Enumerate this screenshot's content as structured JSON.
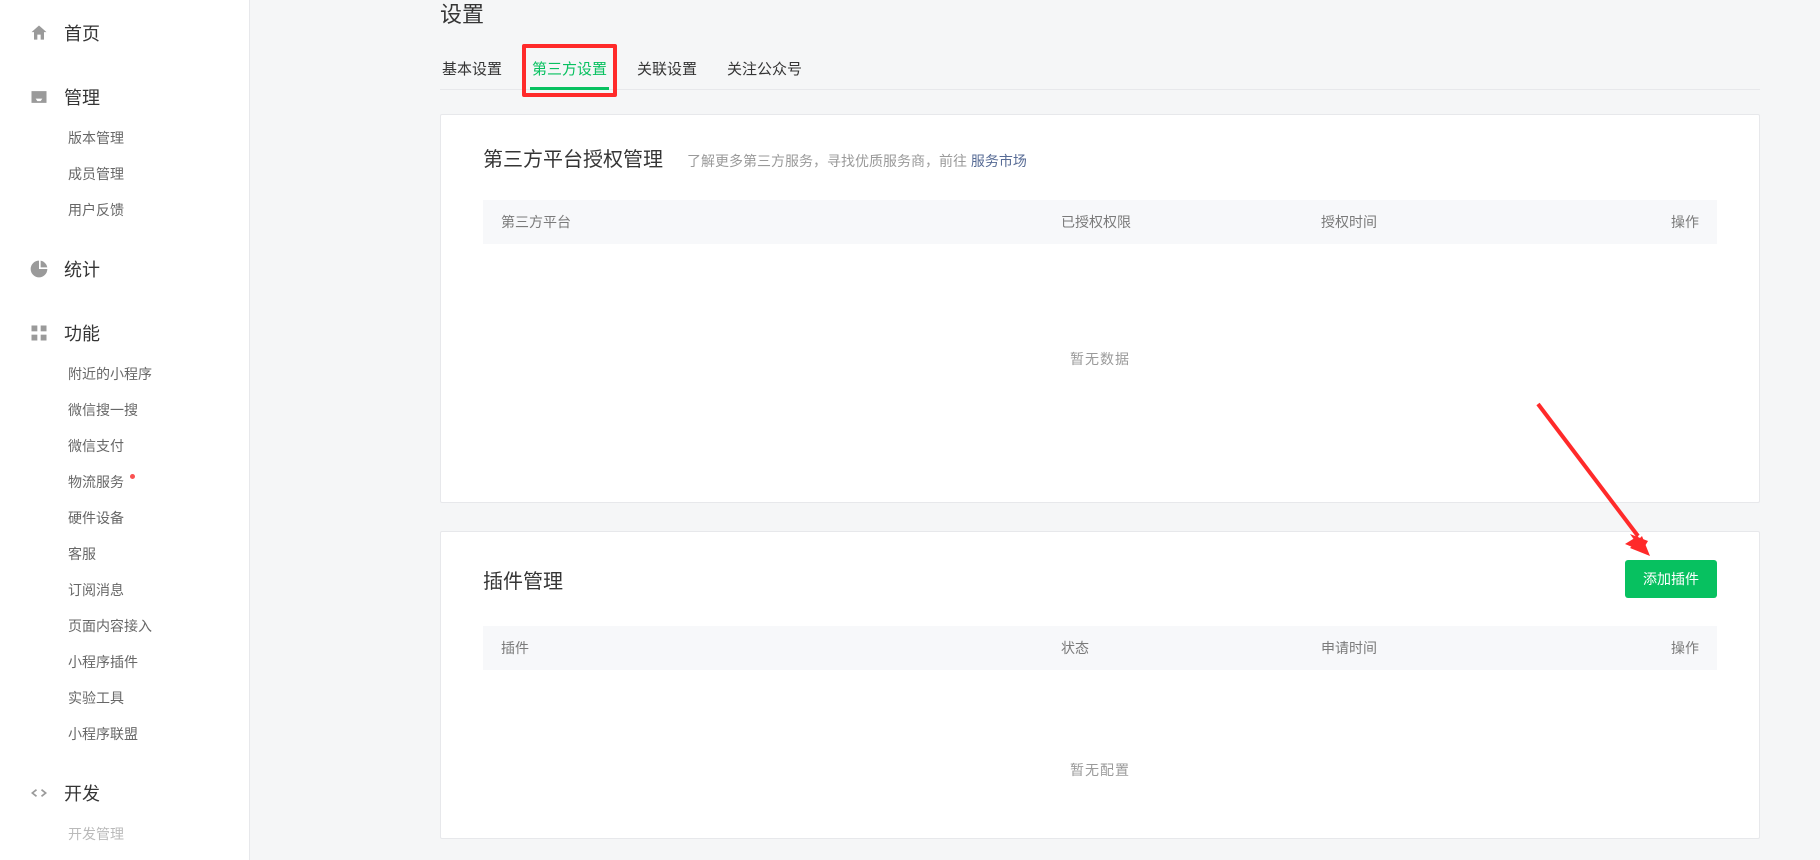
{
  "sidebar": {
    "home": "首页",
    "manage": "管理",
    "manage_items": [
      "版本管理",
      "成员管理",
      "用户反馈"
    ],
    "stats": "统计",
    "features": "功能",
    "feature_items": [
      {
        "label": "附近的小程序"
      },
      {
        "label": "微信搜一搜"
      },
      {
        "label": "微信支付"
      },
      {
        "label": "物流服务",
        "dot": true
      },
      {
        "label": "硬件设备"
      },
      {
        "label": "客服"
      },
      {
        "label": "订阅消息"
      },
      {
        "label": "页面内容接入"
      },
      {
        "label": "小程序插件"
      },
      {
        "label": "实验工具"
      },
      {
        "label": "小程序联盟"
      }
    ],
    "develop": "开发",
    "develop_items": [
      "开发管理"
    ]
  },
  "page": {
    "title": "设置",
    "tabs": [
      "基本设置",
      "第三方设置",
      "关联设置",
      "关注公众号"
    ],
    "active_tab_index": 1
  },
  "auth": {
    "title": "第三方平台授权管理",
    "desc_prefix": "了解更多第三方服务，寻找优质服务商，前往 ",
    "desc_link": "服务市场",
    "cols": [
      "第三方平台",
      "已授权权限",
      "授权时间",
      "操作"
    ],
    "empty": "暂无数据"
  },
  "plugin": {
    "title": "插件管理",
    "add_btn": "添加插件",
    "cols": [
      "插件",
      "状态",
      "申请时间",
      "操作"
    ],
    "empty": "暂无配置"
  }
}
